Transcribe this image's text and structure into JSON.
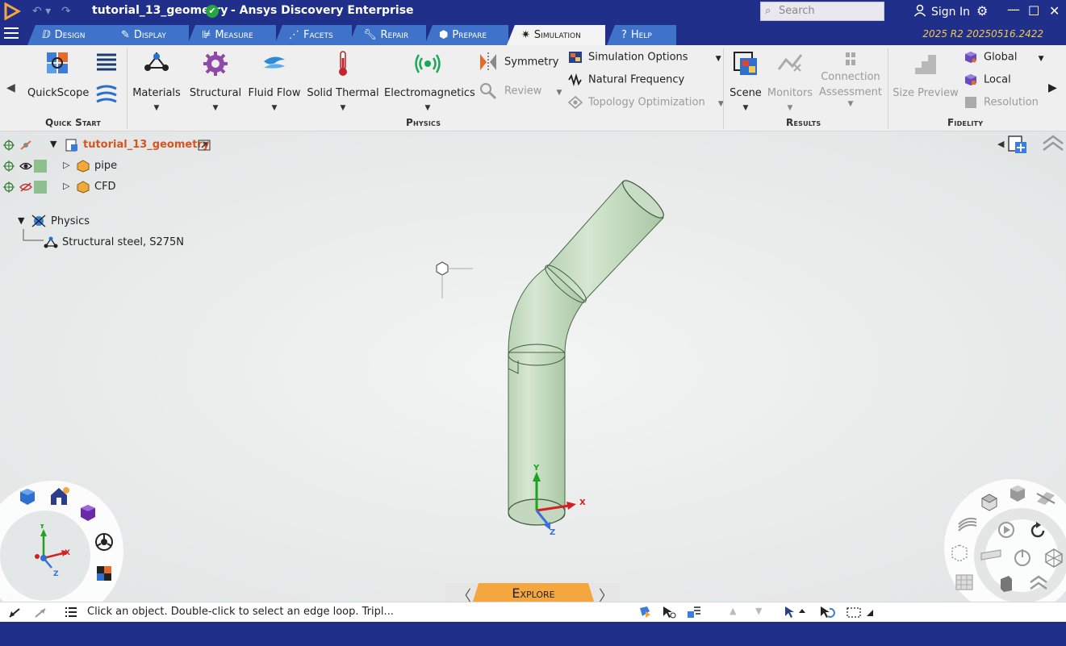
{
  "titlebar": {
    "document_name": "tutorial_13_geometry",
    "app_name": "- Ansys Discovery Enterprise",
    "search_placeholder": "Search",
    "sign_in": "Sign In"
  },
  "tabs": [
    {
      "label": "Design"
    },
    {
      "label": "Display"
    },
    {
      "label": "Measure"
    },
    {
      "label": "Facets"
    },
    {
      "label": "Repair"
    },
    {
      "label": "Prepare"
    },
    {
      "label": "Simulation"
    },
    {
      "label": "Help"
    }
  ],
  "version": "2025 R2 20250516.2422",
  "ribbon": {
    "quick_start": {
      "title": "Quick Start",
      "quickscope": "QuickScope"
    },
    "physics": {
      "title": "Physics",
      "materials": "Materials",
      "structural": "Structural",
      "fluid_flow": "Fluid Flow",
      "solid_thermal": "Solid Thermal",
      "electromagnetics": "Electromagnetics",
      "symmetry": "Symmetry",
      "review": "Review",
      "simulation_options": "Simulation Options",
      "natural_frequency": "Natural Frequency",
      "topology_optimization": "Topology Optimization"
    },
    "results": {
      "title": "Results",
      "scene": "Scene",
      "monitors": "Monitors",
      "connection": "Connection",
      "assessment": "Assessment"
    },
    "fidelity": {
      "title": "Fidelity",
      "size_preview": "Size Preview",
      "global": "Global",
      "local": "Local",
      "resolution": "Resolution"
    }
  },
  "tree": {
    "root": "tutorial_13_geometry",
    "items": [
      "pipe",
      "CFD"
    ],
    "physics_label": "Physics",
    "material": "Structural steel, S275N"
  },
  "axis": {
    "x": "X",
    "y": "Y",
    "z": "Z"
  },
  "explore_label": "Explore",
  "status_text": "Click an object. Double-click to select an edge loop. Tripl..."
}
